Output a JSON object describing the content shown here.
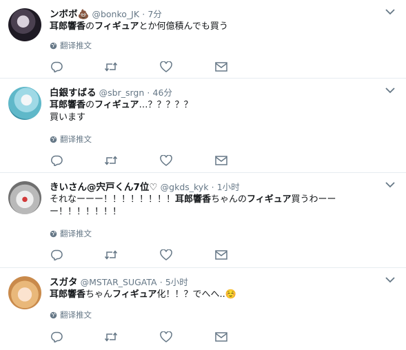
{
  "tweets": [
    {
      "name": "ンボボ💩",
      "handle": "@bonko_JK",
      "time": "7分",
      "lines": [
        [
          {
            "t": "耳郎響香",
            "b": true
          },
          {
            "t": "の"
          },
          {
            "t": "フィギュア",
            "b": true
          },
          {
            "t": "とか何億積んでも買う"
          }
        ]
      ],
      "translate": "翻译推文"
    },
    {
      "name": "白銀すばる",
      "handle": "@sbr_srgn",
      "time": "46分",
      "lines": [
        [
          {
            "t": "耳郎響香",
            "b": true
          },
          {
            "t": "の"
          },
          {
            "t": "フィギュア",
            "b": true
          },
          {
            "t": "…？？？？？"
          }
        ],
        [
          {
            "t": "買います"
          }
        ]
      ],
      "translate": "翻译推文"
    },
    {
      "name": "きいさん@宍戸くん7位♡",
      "handle": "@gkds_kyk",
      "time": "1小时",
      "lines": [
        [
          {
            "t": "それなーーー！！！！！！！！"
          },
          {
            "t": "耳郎響香",
            "b": true
          },
          {
            "t": "ちゃんの"
          },
          {
            "t": "フィギュア",
            "b": true
          },
          {
            "t": "買うわーー"
          }
        ],
        [
          {
            "t": "ー！！！！！！！"
          }
        ]
      ],
      "translate": "翻译推文"
    },
    {
      "name": "スガタ",
      "handle": "@MSTAR_SUGATA",
      "time": "5小时",
      "lines": [
        [
          {
            "t": "耳郎響香",
            "b": true
          },
          {
            "t": "ちゃん"
          },
          {
            "t": "フィギュア",
            "b": true
          },
          {
            "t": "化！！？でへへ..☺️"
          }
        ]
      ],
      "translate": "翻译推文"
    }
  ],
  "icons": {
    "chevron": "chevron-down-icon",
    "globe": "globe-icon",
    "reply": "reply-icon",
    "retweet": "retweet-icon",
    "like": "heart-icon",
    "dm": "envelope-icon"
  },
  "colors": {
    "text": "#14171a",
    "muted": "#657786",
    "icon": "#657786",
    "divider": "#e6ecf0"
  }
}
